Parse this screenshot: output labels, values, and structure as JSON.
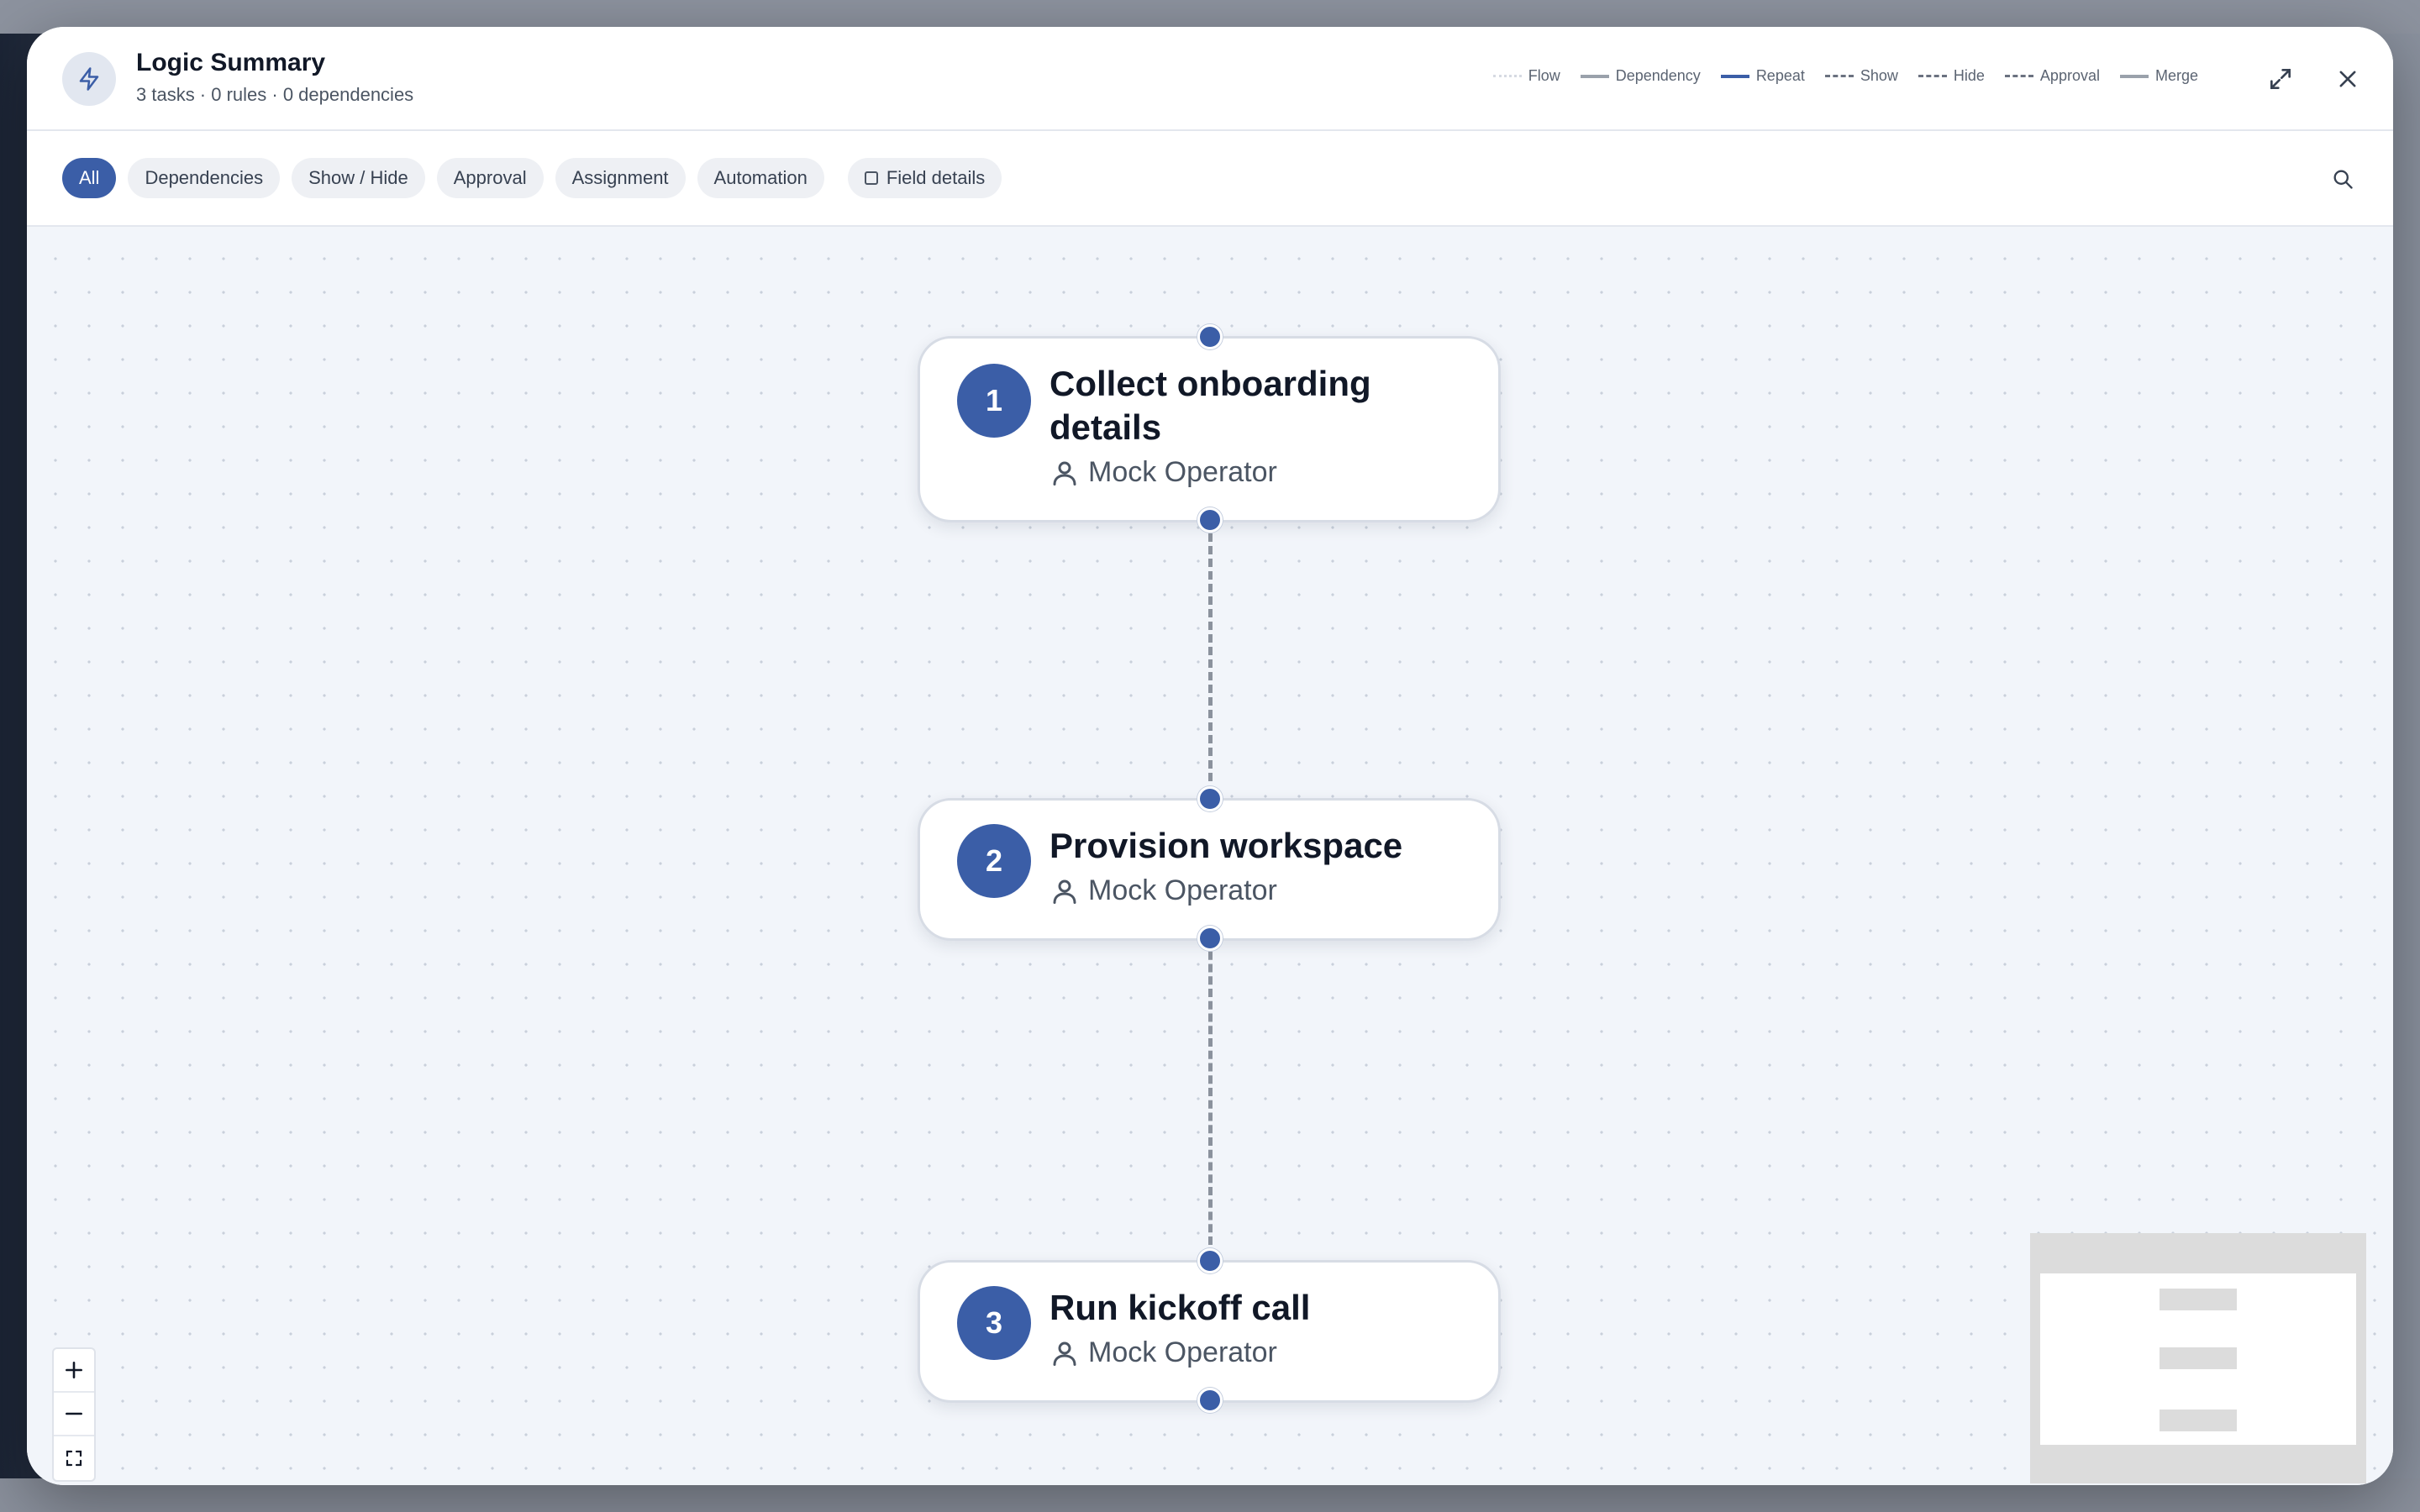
{
  "header": {
    "title": "Logic Summary",
    "subtitle": "3 tasks · 0 rules · 0 dependencies"
  },
  "legend": [
    {
      "label": "Flow",
      "style": "dotted",
      "color": "#d6dae2"
    },
    {
      "label": "Dependency",
      "style": "solid",
      "color": "#9aa1ab"
    },
    {
      "label": "Repeat",
      "style": "solid",
      "color": "#3b5ea7"
    },
    {
      "label": "Show",
      "style": "dashed",
      "color": "#6b7280"
    },
    {
      "label": "Hide",
      "style": "dashed",
      "color": "#6b7280"
    },
    {
      "label": "Approval",
      "style": "dashed",
      "color": "#6b7280"
    },
    {
      "label": "Merge",
      "style": "solid",
      "color": "#9aa1ab"
    }
  ],
  "filters": {
    "chips": [
      "All",
      "Dependencies",
      "Show / Hide",
      "Approval",
      "Assignment",
      "Automation"
    ],
    "active": "All",
    "field_details_label": "Field details"
  },
  "nodes": [
    {
      "number": "1",
      "title": "Collect onboarding details",
      "assignee": "Mock Operator"
    },
    {
      "number": "2",
      "title": "Provision workspace",
      "assignee": "Mock Operator"
    },
    {
      "number": "3",
      "title": "Run kickoff call",
      "assignee": "Mock Operator"
    }
  ],
  "colors": {
    "accent": "#3b5ea7",
    "canvas_bg": "#f2f5fa",
    "connector": "#8b929d"
  },
  "icons": {
    "header": "lightning-icon",
    "expand": "expand-icon",
    "close": "close-icon",
    "search": "search-icon",
    "assignee": "person-icon",
    "zoom_in": "plus-icon",
    "zoom_out": "minus-icon",
    "fit": "fit-view-icon"
  }
}
